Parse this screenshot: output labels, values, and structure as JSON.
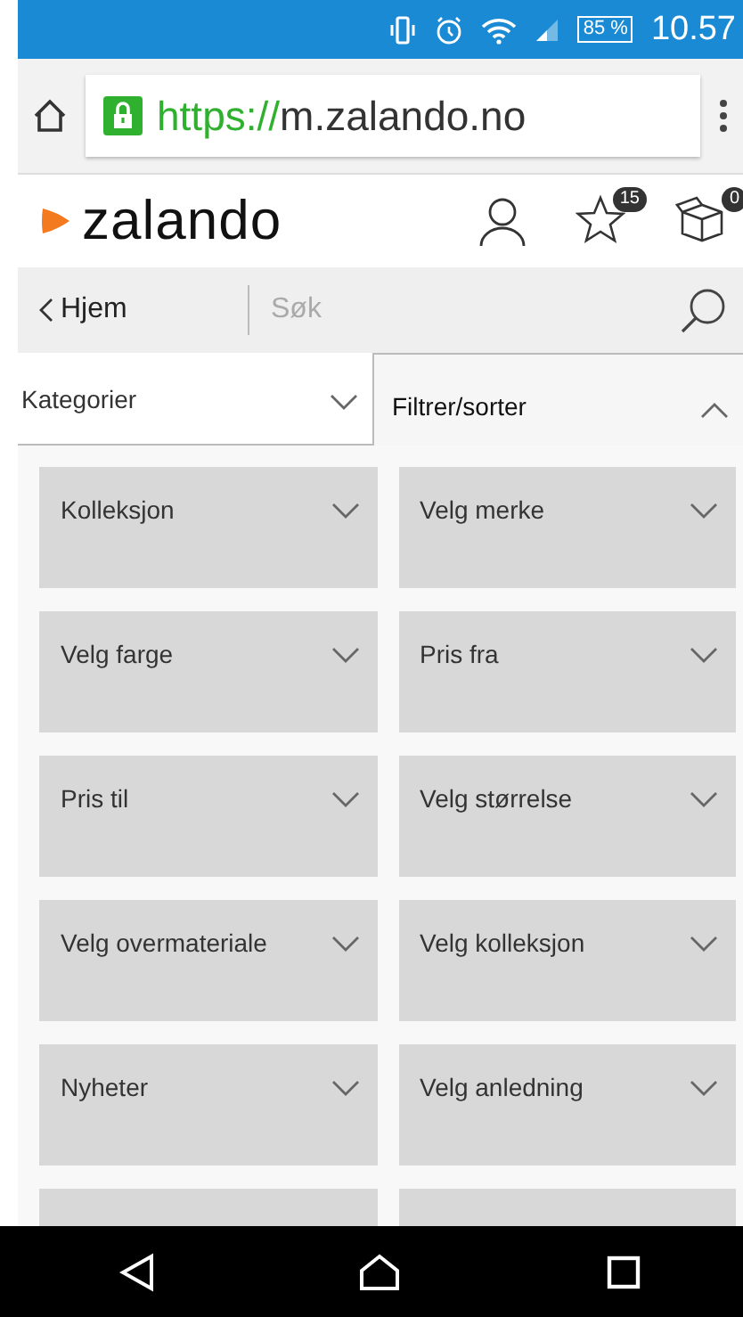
{
  "status_bar": {
    "battery": "85 %",
    "time": "10.57"
  },
  "browser": {
    "url_scheme": "https://",
    "url_host": "m.zalando.no"
  },
  "header": {
    "logo": "zalando",
    "wishlist_count": "15",
    "cart_count": "0"
  },
  "search": {
    "back_label": "Hjem",
    "placeholder": "Søk"
  },
  "tabs": [
    {
      "label": "Kategorier",
      "selected": false,
      "expanded": false
    },
    {
      "label": "Filtrer/sorter",
      "selected": true,
      "expanded": true
    }
  ],
  "filters": [
    {
      "label": "Kolleksjon"
    },
    {
      "label": "Velg merke"
    },
    {
      "label": "Velg farge"
    },
    {
      "label": "Pris fra"
    },
    {
      "label": "Pris til"
    },
    {
      "label": "Velg størrelse"
    },
    {
      "label": "Velg overmateriale"
    },
    {
      "label": "Velg kolleksjon"
    },
    {
      "label": "Nyheter"
    },
    {
      "label": "Velg anledning"
    }
  ]
}
